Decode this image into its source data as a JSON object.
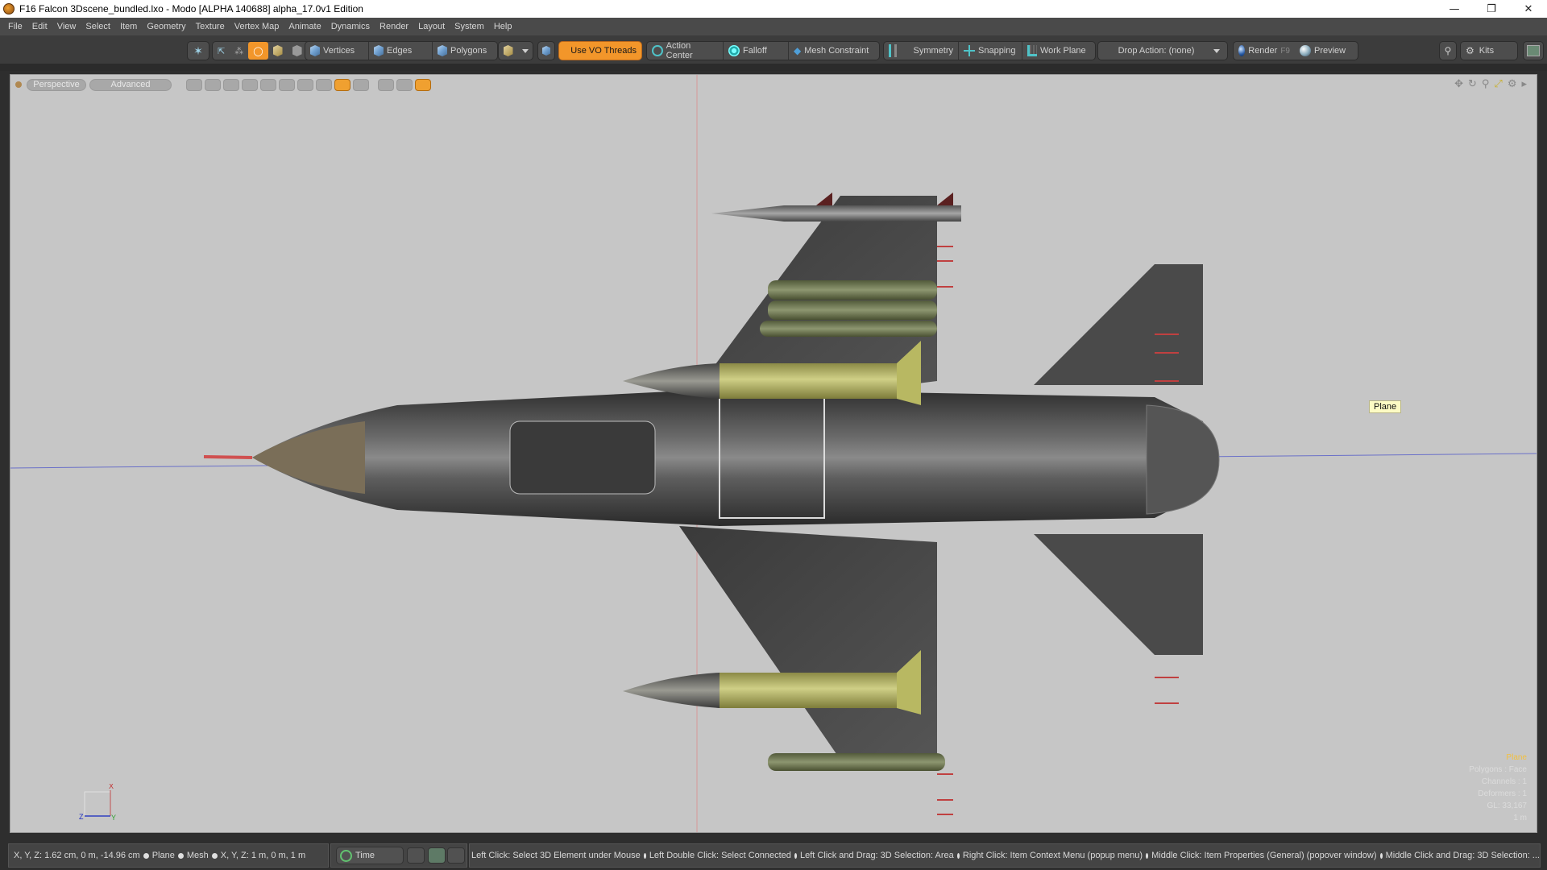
{
  "window": {
    "title": "F16 Falcon 3Dscene_bundled.lxo - Modo [ALPHA 140688]   alpha_17.0v1 Edition",
    "controls": {
      "minimize": "—",
      "restore": "❐",
      "close": "✕"
    }
  },
  "menu": [
    "File",
    "Edit",
    "View",
    "Select",
    "Item",
    "Geometry",
    "Texture",
    "Vertex Map",
    "Animate",
    "Dynamics",
    "Render",
    "Layout",
    "System",
    "Help"
  ],
  "toolbar": {
    "selection_modes": {
      "vertices": "Vertices",
      "edges": "Edges",
      "polygons": "Polygons"
    },
    "use_vo_threads": "Use VO Threads",
    "action_center": "Action Center",
    "falloff": "Falloff",
    "mesh_constraint": "Mesh Constraint",
    "symmetry": "Symmetry",
    "snapping": "Snapping",
    "work_plane": "Work Plane",
    "drop_action": "Drop Action: (none)",
    "render": "Render",
    "render_shortcut": "F9",
    "preview": "Preview",
    "kits": "Kits",
    "colors": {
      "accent": "#f2962a",
      "tool_icon": "#4fc3c8"
    }
  },
  "viewport": {
    "view_mode": "Perspective",
    "shading_mode": "Advanced",
    "background": "#c6c6c6",
    "tooltip": "Plane",
    "axis_labels": {
      "x": "X",
      "y": "Y",
      "z": "Z"
    },
    "info_overlay": [
      "Plane",
      "Polygons : Face",
      "Channels : 1",
      "Deformers : 1",
      "GL: 33,167",
      "1 m"
    ]
  },
  "status": {
    "readout": "X, Y, Z:   1.62 cm, 0 m, -14.96 cm",
    "item_type": "Plane",
    "item_kind": "Mesh",
    "size_readout": "X, Y, Z:   1 m, 0 m, 1 m",
    "time_label": "Time",
    "hints": [
      "Left Click: Select 3D Element under Mouse",
      "Left Double Click: Select Connected",
      "Left Click and Drag: 3D Selection: Area",
      "Right Click: Item Context Menu (popup menu)",
      "Middle Click: Item Properties (General) (popover window)",
      "Middle Click and Drag: 3D Selection: ..."
    ]
  }
}
